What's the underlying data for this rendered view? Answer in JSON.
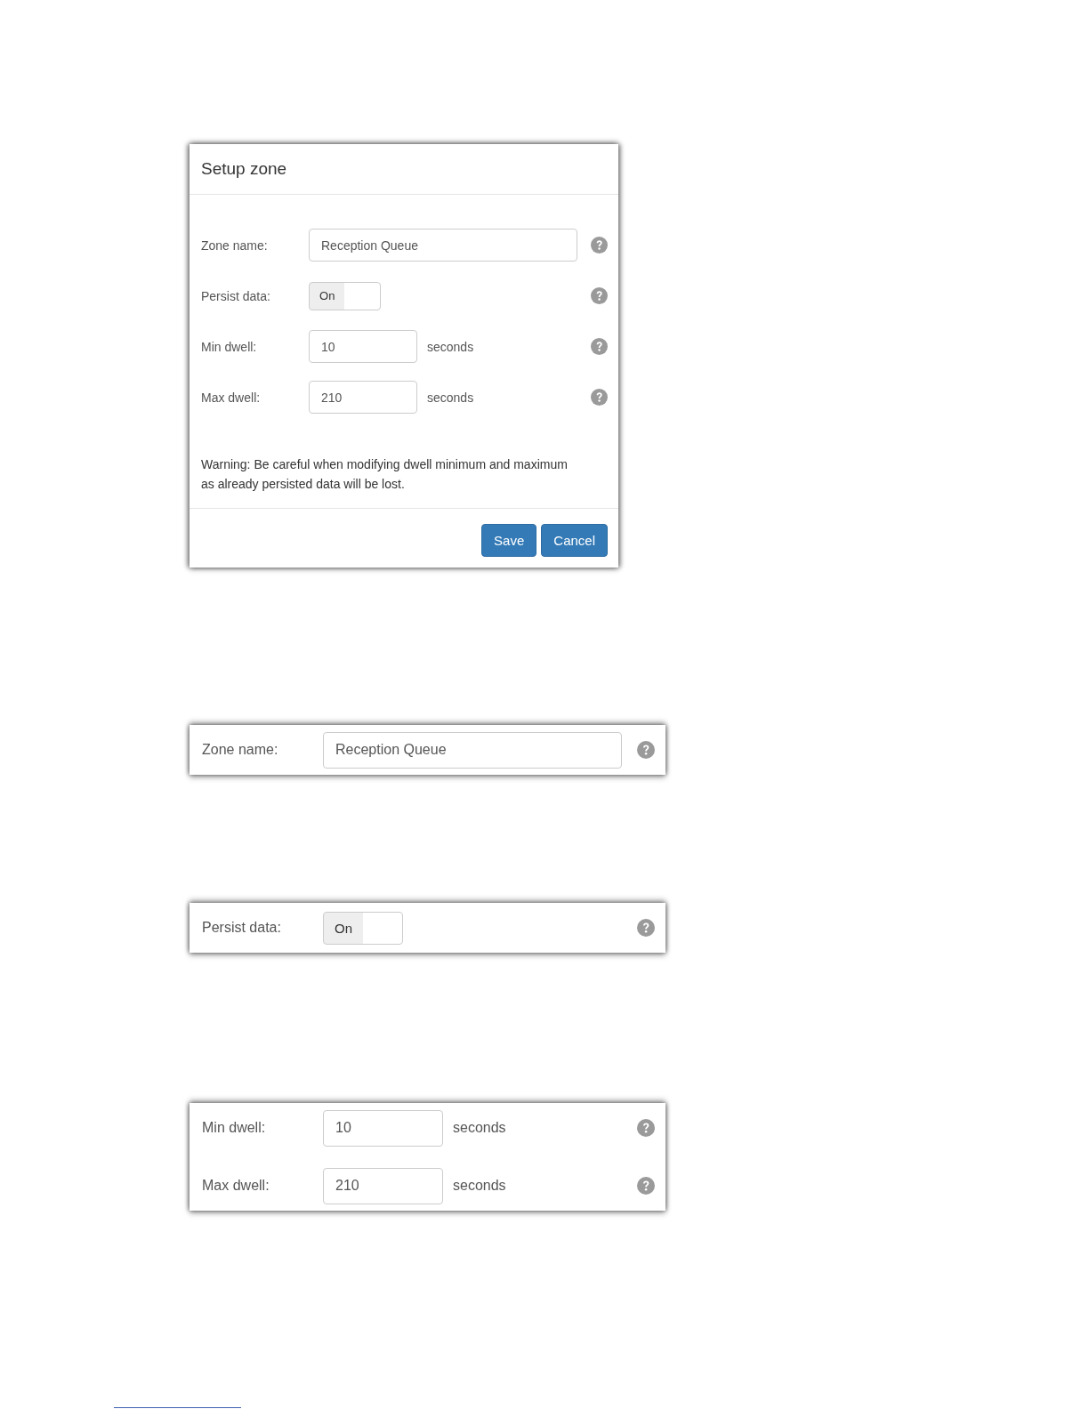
{
  "dialog": {
    "title": "Setup zone",
    "fields": [
      {
        "kind": "text",
        "label": "Zone name:",
        "value": "Reception Queue"
      },
      {
        "kind": "toggle",
        "label": "Persist data:",
        "on": true,
        "text": "On"
      },
      {
        "kind": "number",
        "label": "Min dwell:",
        "value": "10",
        "unit": "seconds"
      },
      {
        "kind": "number",
        "label": "Max dwell:",
        "value": "210",
        "unit": "seconds"
      }
    ],
    "warning": "Warning: Be careful when modifying dwell minimum and maximum as already persisted data will be lost.",
    "buttons": [
      "Save",
      "Cancel"
    ]
  },
  "excerpts": [
    {
      "fields": [
        {
          "kind": "text",
          "label": "Zone name:",
          "value": "Reception Queue"
        }
      ]
    },
    {
      "fields": [
        {
          "kind": "toggle",
          "label": "Persist data:",
          "on": true,
          "text": "On"
        }
      ]
    },
    {
      "fields": [
        {
          "kind": "number",
          "label": "Min dwell:",
          "value": "10",
          "unit": "seconds"
        },
        {
          "kind": "number",
          "label": "Max dwell:",
          "value": "210",
          "unit": "seconds"
        }
      ]
    }
  ]
}
